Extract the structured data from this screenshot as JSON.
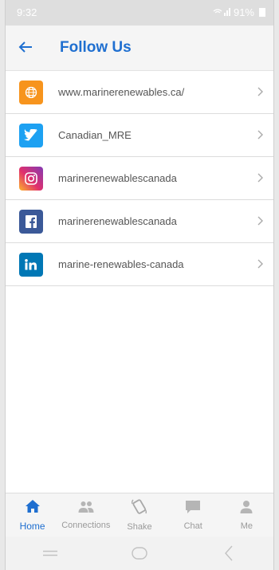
{
  "status_bar": {
    "time": "9:32",
    "battery": "91%"
  },
  "header": {
    "title": "Follow Us",
    "back_icon": "arrow-left-icon"
  },
  "links": [
    {
      "icon": "globe-icon",
      "color": "#f7941d",
      "label": "www.marinerenewables.ca/"
    },
    {
      "icon": "twitter-icon",
      "color": "#1da1f2",
      "label": "Canadian_MRE"
    },
    {
      "icon": "instagram-icon",
      "color": "#d6249f",
      "label": "marinerenewablescanada"
    },
    {
      "icon": "facebook-icon",
      "color": "#3b5998",
      "label": "marinerenewablescanada"
    },
    {
      "icon": "linkedin-icon",
      "color": "#0077b5",
      "label": "marine-renewables-canada"
    }
  ],
  "tabs": [
    {
      "label": "Home",
      "icon": "home-icon",
      "active": true
    },
    {
      "label": "Connections",
      "icon": "people-icon",
      "active": false
    },
    {
      "label": "Shake",
      "icon": "shake-phone-icon",
      "active": false
    },
    {
      "label": "Chat",
      "icon": "chat-icon",
      "active": false
    },
    {
      "label": "Me",
      "icon": "person-icon",
      "active": false
    }
  ],
  "colors": {
    "accent": "#1f6fd0",
    "inactive": "#9a9a9a"
  }
}
